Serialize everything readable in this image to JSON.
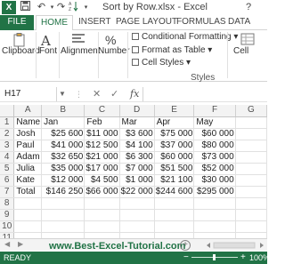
{
  "window": {
    "title": "Sort by Row.xlsx - Excel",
    "help": "?"
  },
  "tabs": [
    "FILE",
    "HOME",
    "INSERT",
    "PAGE LAYOUT",
    "FORMULAS",
    "DATA"
  ],
  "ribbon": {
    "clipboard_label": "Clipboard",
    "font_label": "Font",
    "alignment_label": "Alignment",
    "number_label": "Number",
    "percent_symbol": "%",
    "styles_caption": "Styles",
    "cells_label": "Cell",
    "conditional_formatting": "Conditional Formatting",
    "format_as_table": "Format as Table",
    "cell_styles": "Cell Styles",
    "dropdown_glyph": "▾"
  },
  "formula_bar": {
    "name_box": "H17",
    "cancel": "✕",
    "enter": "✓",
    "fx": "fx",
    "formula": ""
  },
  "sheet": {
    "columns": [
      "A",
      "B",
      "C",
      "D",
      "E",
      "F",
      "G"
    ],
    "rows": [
      {
        "n": "1",
        "cells": [
          "Name",
          "Jan",
          "Feb",
          "Mar",
          "Apr",
          "May",
          ""
        ]
      },
      {
        "n": "2",
        "cells": [
          "Josh",
          "$25 600",
          "$11 000",
          "$3 600",
          "$75 000",
          "$60 000",
          ""
        ]
      },
      {
        "n": "3",
        "cells": [
          "Paul",
          "$41 000",
          "$12 500",
          "$4 100",
          "$37 000",
          "$80 000",
          ""
        ]
      },
      {
        "n": "4",
        "cells": [
          "Adam",
          "$32 650",
          "$21 000",
          "$6 300",
          "$60 000",
          "$73 000",
          ""
        ]
      },
      {
        "n": "5",
        "cells": [
          "Julia",
          "$35 000",
          "$17 000",
          "$7 000",
          "$51 500",
          "$52 000",
          ""
        ]
      },
      {
        "n": "6",
        "cells": [
          "Kate",
          "$12 000",
          "$4 500",
          "$1 000",
          "$21 100",
          "$30 000",
          ""
        ]
      },
      {
        "n": "7",
        "cells": [
          "Total",
          "$146 250",
          "$66 000",
          "$22 000",
          "$244 600",
          "$295 000",
          ""
        ]
      },
      {
        "n": "8",
        "cells": [
          "",
          "",
          "",
          "",
          "",
          "",
          ""
        ]
      },
      {
        "n": "9",
        "cells": [
          "",
          "",
          "",
          "",
          "",
          "",
          ""
        ]
      },
      {
        "n": "10",
        "cells": [
          "",
          "",
          "",
          "",
          "",
          "",
          ""
        ]
      },
      {
        "n": "11",
        "cells": [
          "",
          "",
          "",
          "",
          "",
          "",
          ""
        ]
      }
    ]
  },
  "sheet_bar": {
    "nav_prev": "◀",
    "nav_next": "▶",
    "watermark": "www.Best-Excel-Tutorial.com",
    "add_sheet": "+"
  },
  "status": {
    "ready": "READY",
    "zoom_minus": "−",
    "zoom_plus": "+",
    "zoom": "100%"
  },
  "colors": {
    "excel_green": "#217346"
  }
}
